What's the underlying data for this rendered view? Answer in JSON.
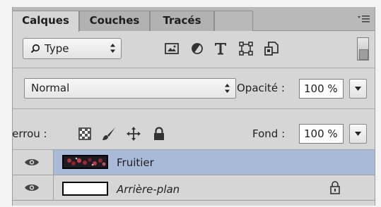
{
  "tabs": [
    {
      "label": "Calques",
      "active": true
    },
    {
      "label": "Couches",
      "active": false
    },
    {
      "label": "Tracés",
      "active": false
    }
  ],
  "filter": {
    "kind_label": "Type",
    "icons": [
      "image-filter-icon",
      "adjustment-filter-icon",
      "type-filter-icon",
      "shape-filter-icon",
      "smart-object-filter-icon",
      "filter-toggle-switch"
    ]
  },
  "blend": {
    "mode": "Normal",
    "opacity_label": "Opacité :",
    "opacity_value": "100 %"
  },
  "locks": {
    "label": "Verrou :",
    "icons": [
      "lock-transparent-pixels-icon",
      "lock-image-pixels-icon",
      "lock-position-icon",
      "lock-all-icon"
    ],
    "fill_label": "Fond :",
    "fill_value": "100 %"
  },
  "layers": [
    {
      "name": "Fruitier",
      "selected": true,
      "visible": true,
      "locked": false,
      "italic": false
    },
    {
      "name": "Arrière-plan",
      "selected": false,
      "visible": true,
      "locked": true,
      "italic": true
    }
  ],
  "colors": {
    "panel_bg": "#d6d6d6",
    "tab_bar": "#b9b9b9",
    "selected_layer": "#a9bad9",
    "input_bg": "#ffffff"
  }
}
